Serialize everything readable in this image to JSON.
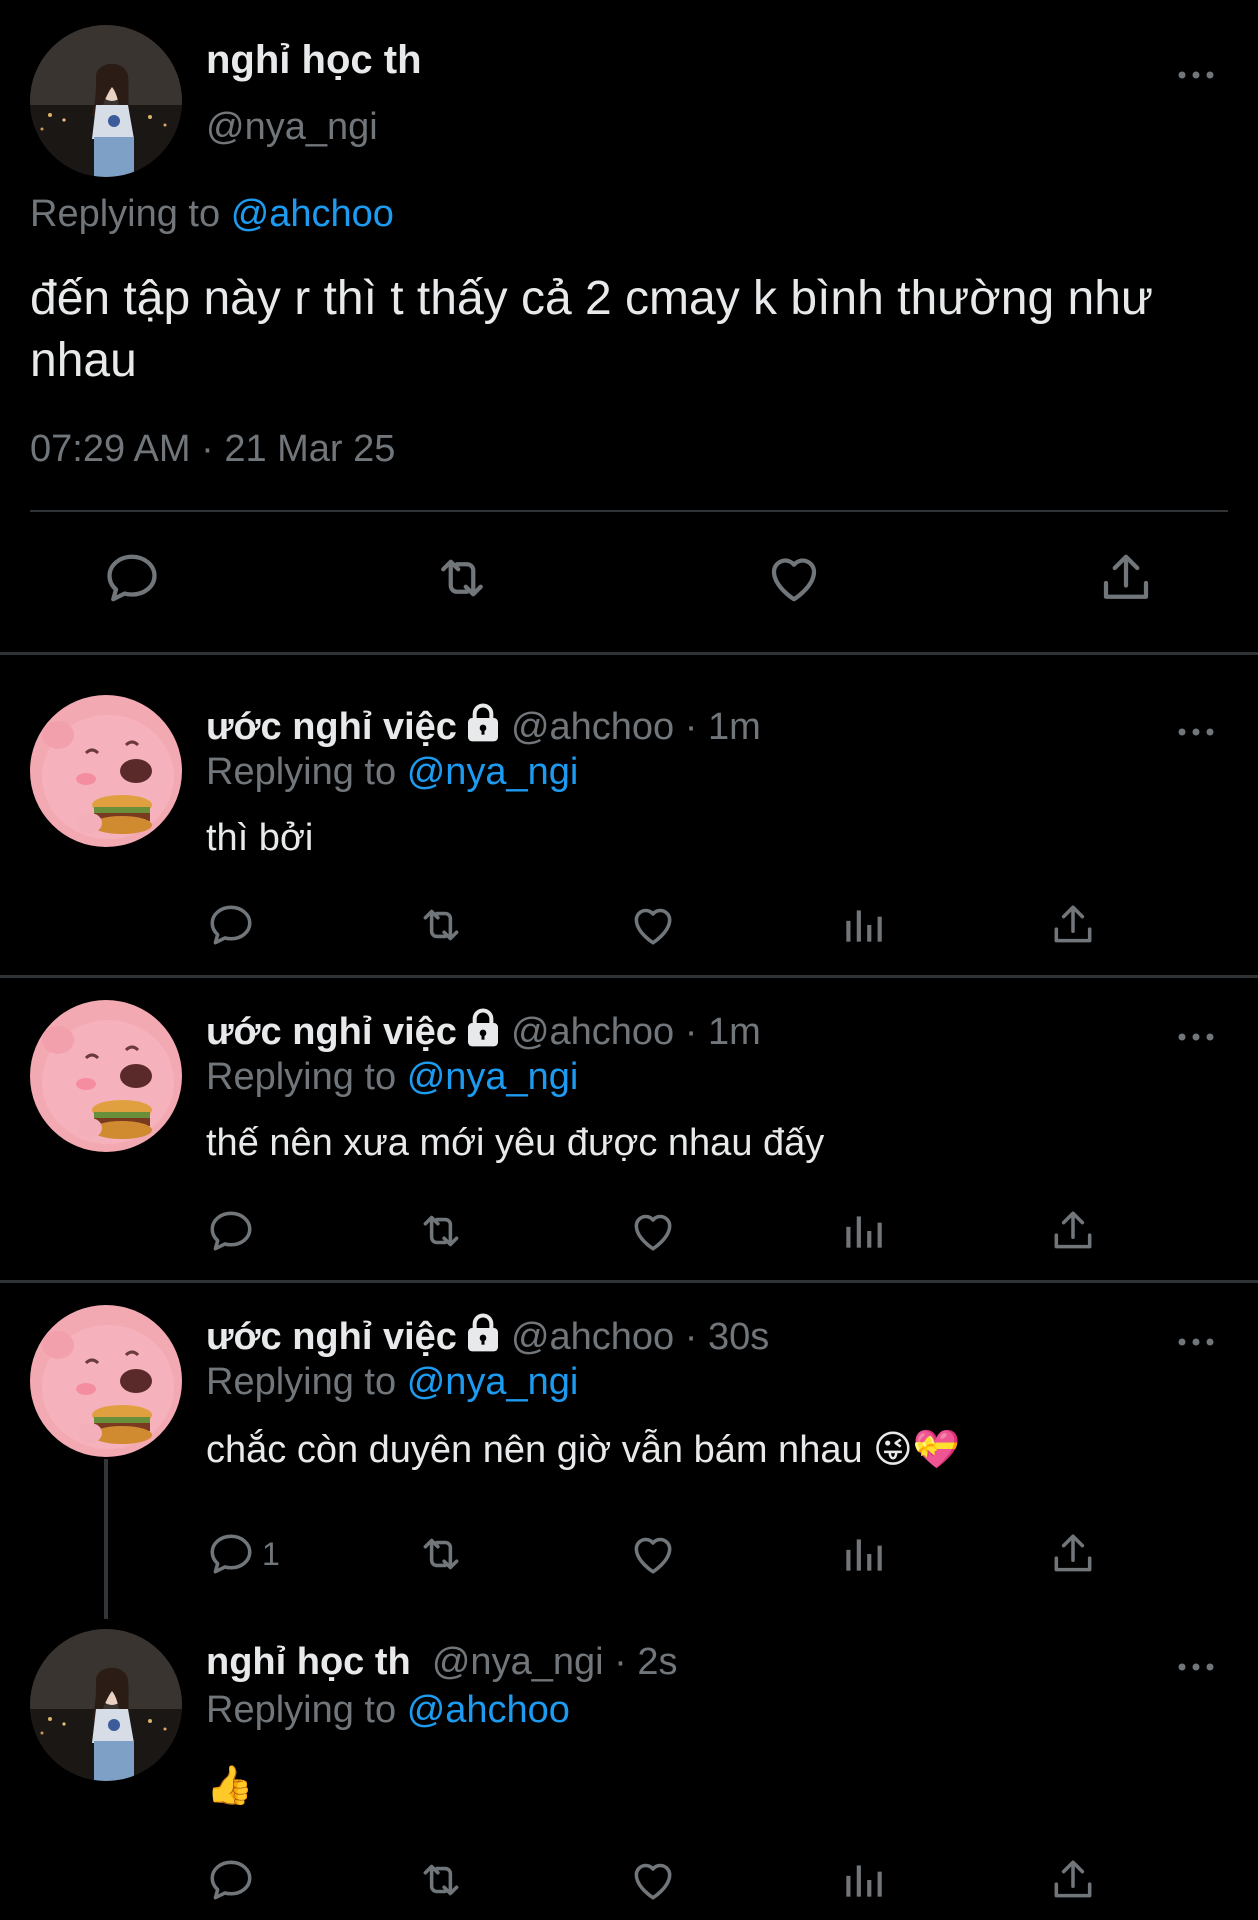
{
  "main_tweet": {
    "author_name": "nghỉ học th",
    "author_handle": "@nya_ngi",
    "replying_label": "Replying to",
    "replying_handle": "@ahchoo",
    "text": "đến tập này r thì t thấy cả 2 cmay k bình thường như nhau",
    "timestamp": "07:29 AM · 21 Mar 25"
  },
  "replies": [
    {
      "author_name": "ước nghỉ việc",
      "meta": "@ahchoo · 1m",
      "replying_label": "Replying to",
      "replying_handle": "@nya_ngi",
      "text": "thì bởi",
      "reply_count": ""
    },
    {
      "author_name": "ước nghỉ việc",
      "meta": "@ahchoo · 1m",
      "replying_label": "Replying to",
      "replying_handle": "@nya_ngi",
      "text": "thế nên xưa mới yêu được nhau đấy",
      "reply_count": ""
    },
    {
      "author_name": "ước nghỉ việc",
      "meta": "@ahchoo · 30s",
      "replying_label": "Replying to",
      "replying_handle": "@nya_ngi",
      "text": "chắc còn duyên nên giờ vẫn bám nhau",
      "emojis": "😜💝",
      "reply_count": "1"
    },
    {
      "author_name": "nghỉ học th",
      "meta": "@nya_ngi · 2s",
      "replying_label": "Replying to",
      "replying_handle": "@ahchoo",
      "text": "👍",
      "reply_count": ""
    }
  ],
  "colors": {
    "background": "#000000",
    "text": "#e7e9ea",
    "muted": "#71767b",
    "link": "#1d9bf0",
    "divider": "#2f3336"
  },
  "icons": [
    "reply-icon",
    "retweet-icon",
    "like-icon",
    "views-icon",
    "share-icon",
    "more-icon",
    "lock-icon"
  ]
}
